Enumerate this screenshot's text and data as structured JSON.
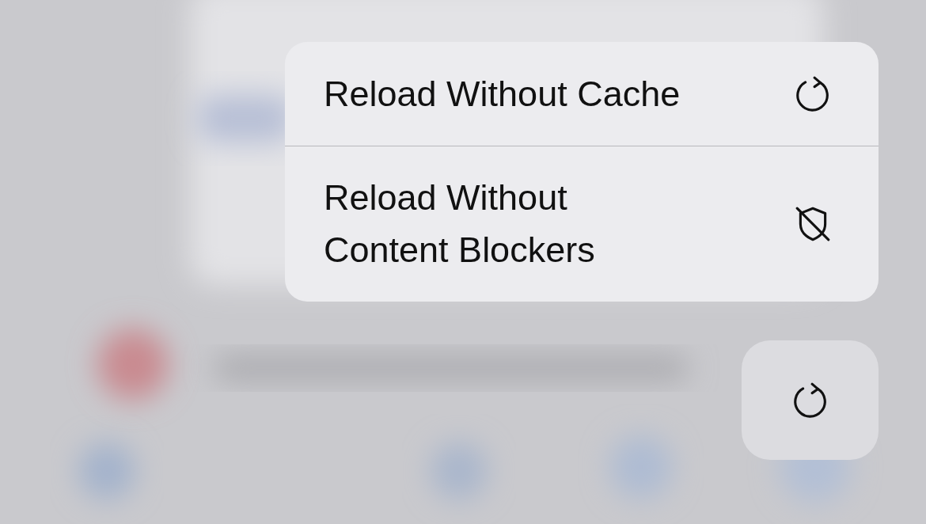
{
  "menu": {
    "items": [
      {
        "label": "Reload Without Cache",
        "kind": "reload"
      },
      {
        "label": "Reload Without\nContent Blockers",
        "kind": "shield-off"
      }
    ]
  },
  "button": {
    "kind": "reload"
  }
}
